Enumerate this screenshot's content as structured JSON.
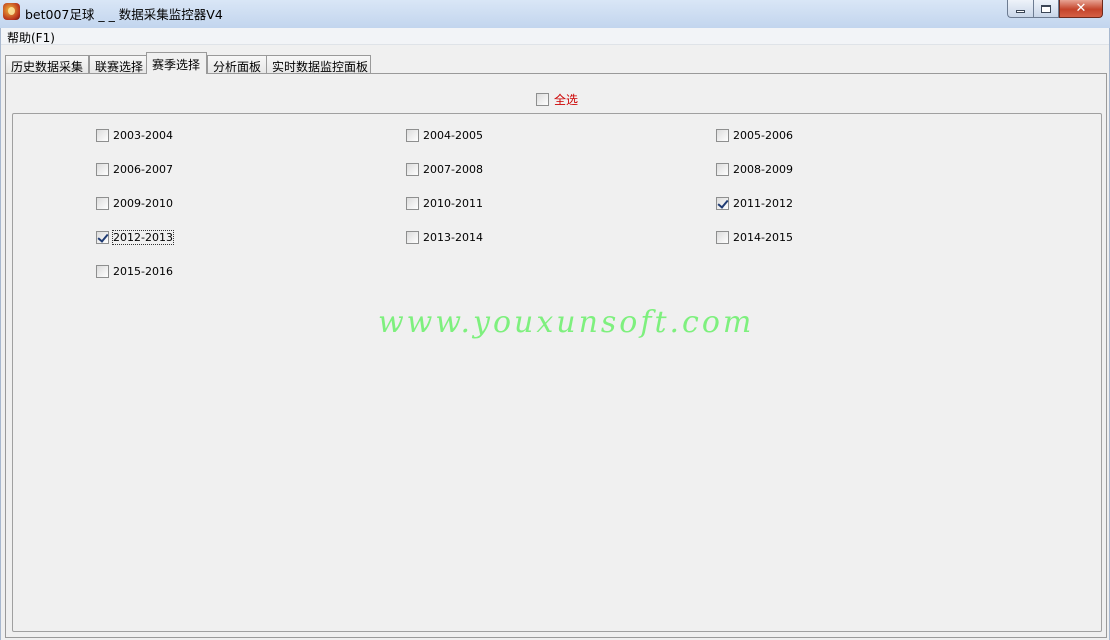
{
  "window": {
    "title": "bet007足球 _ _ 数据采集监控器V4",
    "controls": {
      "minimize": "minimize-icon",
      "maximize": "maximize-icon",
      "close": "close-icon"
    }
  },
  "menubar": {
    "items": [
      {
        "label": "帮助(F1)"
      }
    ]
  },
  "tabs": [
    {
      "label": "历史数据采集",
      "active": false
    },
    {
      "label": "联赛选择",
      "active": false
    },
    {
      "label": "赛季选择",
      "active": true
    },
    {
      "label": "分析面板",
      "active": false
    },
    {
      "label": "实时数据监控面板",
      "active": false
    }
  ],
  "select_all": {
    "label": "全选",
    "checked": false,
    "color": "#cc0000"
  },
  "seasons": [
    {
      "label": "2003-2004",
      "checked": false
    },
    {
      "label": "2004-2005",
      "checked": false
    },
    {
      "label": "2005-2006",
      "checked": false
    },
    {
      "label": "2006-2007",
      "checked": false
    },
    {
      "label": "2007-2008",
      "checked": false
    },
    {
      "label": "2008-2009",
      "checked": false
    },
    {
      "label": "2009-2010",
      "checked": false
    },
    {
      "label": "2010-2011",
      "checked": false
    },
    {
      "label": "2011-2012",
      "checked": true
    },
    {
      "label": "2012-2013",
      "checked": true,
      "focused": true
    },
    {
      "label": "2013-2014",
      "checked": false
    },
    {
      "label": "2014-2015",
      "checked": false
    },
    {
      "label": "2015-2016",
      "checked": false
    }
  ],
  "watermark": {
    "text": "www.youxunsoft.com",
    "color": "#6bf06b"
  }
}
